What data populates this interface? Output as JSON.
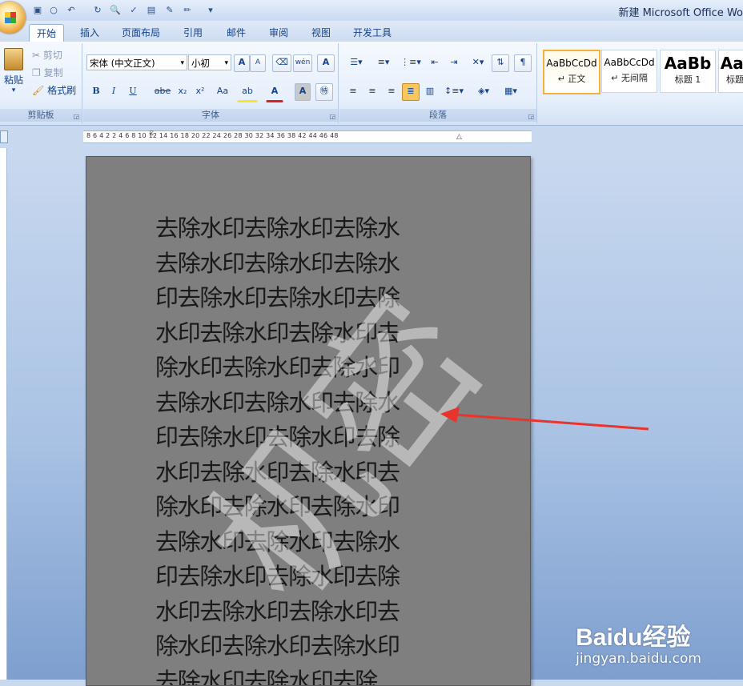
{
  "window": {
    "title": "新建 Microsoft Office Wo"
  },
  "quick_access": [
    "save-icon",
    "redo-icon",
    "undo-icon",
    "repeat-icon",
    "print-preview-icon",
    "clipboard-icon",
    "spelling-icon",
    "macro-icon",
    "draw-icon"
  ],
  "tabs": [
    "开始",
    "插入",
    "页面布局",
    "引用",
    "邮件",
    "审阅",
    "视图",
    "开发工具"
  ],
  "clipboard": {
    "paste": "粘贴",
    "cut": "剪切",
    "copy": "复制",
    "format_painter": "格式刷",
    "label": "剪贴板"
  },
  "font": {
    "name": "宋体 (中文正文)",
    "size": "小初",
    "bold": "B",
    "italic": "I",
    "underline": "U",
    "strike": "abe",
    "sub": "x₂",
    "sup": "x²",
    "case": "Aa",
    "grow": "A",
    "shrink": "A",
    "label": "字体"
  },
  "paragraph": {
    "label": "段落"
  },
  "styles": [
    {
      "sample": "AaBbCcDd",
      "name": "↵ 正文"
    },
    {
      "sample": "AaBbCcDd",
      "name": "↵ 无间隔"
    },
    {
      "sample": "AaBb",
      "name": "标题 1"
    },
    {
      "sample": "AaI",
      "name": "标题"
    }
  ],
  "ruler": {
    "ticks": "8   6   4   2      2   4   6   8  10  12  14  16  18  20  22  24  26  28  30  32  34  36  38     42  44  46  48"
  },
  "document": {
    "lines": [
      "去除水印去除水印去除水",
      "去除水印去除水印去除水",
      "印去除水印去除水印去除",
      "水印去除水印去除水印去",
      "除水印去除水印去除水印",
      "去除水印去除水印去除水",
      "印去除水印去除水印去除",
      "水印去除水印去除水印去",
      "除水印去除水印去除水印",
      "去除水印去除水印去除水",
      "印去除水印去除水印去除",
      "水印去除水印去除水印去",
      "除水印去除水印去除水印",
      "去除水印去除水印去除"
    ],
    "watermark": "机密"
  },
  "overlay": {
    "logo": "Baidu经验",
    "url": "jingyan.baidu.com",
    "arrow_color": "#e8342c"
  }
}
